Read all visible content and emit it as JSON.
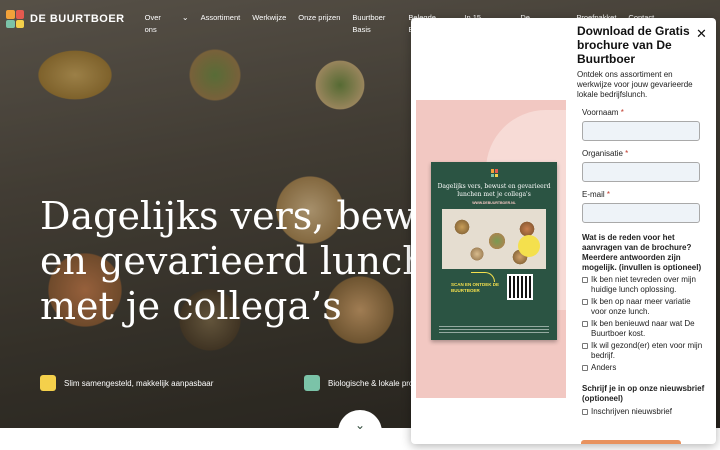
{
  "brand": {
    "name": "DE BUURTBOER",
    "logo_colors": [
      "#f2a23a",
      "#e55a4f",
      "#7bc3a8",
      "#f4d04b"
    ]
  },
  "nav": {
    "items": [
      {
        "label": "Over ons",
        "has_chevron": true
      },
      {
        "label": "Assortiment",
        "has_chevron": false
      },
      {
        "label": "Werkwijze",
        "has_chevron": false
      },
      {
        "label": "Onze prijzen",
        "has_chevron": false
      },
      {
        "label": "Buurtboer Basis",
        "has_chevron": false
      },
      {
        "label": "Belegde Broodjes",
        "has_chevron": false
      },
      {
        "label": "In 15 minuten advies",
        "has_chevron": false
      },
      {
        "label": "De Buurtboer",
        "has_chevron": false
      },
      {
        "label": "Proefpakket",
        "has_chevron": false
      },
      {
        "label": "Contact",
        "has_chevron": false
      }
    ]
  },
  "hero": {
    "headline_lines": [
      "Dagelijks vers, bewust",
      "en gevarieerd lunchen",
      "met je collega’s"
    ]
  },
  "usps": [
    {
      "label": "Slim samengesteld, makkelijk aanpasbaar",
      "icon": "puzzle-icon",
      "color": "#f4d04b"
    },
    {
      "label": "Biologische & lokale producten",
      "icon": "leaf-icon",
      "color": "#7bc3a8"
    }
  ],
  "scroll_button": {
    "icon": "chevron-down-icon",
    "glyph": "⌄"
  },
  "modal": {
    "title": "Download de Gratis brochure van De Buurtboer",
    "close_glyph": "✕",
    "subtitle": "Ontdek ons assortiment en werkwijze voor jouw gevarieerde lokale bedrijfslunch.",
    "fields": [
      {
        "label": "Voornaam",
        "required": true,
        "value": ""
      },
      {
        "label": "Organisatie",
        "required": true,
        "value": ""
      },
      {
        "label": "E-mail",
        "required": true,
        "value": ""
      }
    ],
    "question": "Wat is de reden voor het aanvragen van de brochure? Meerdere antwoorden zijn mogelijk. (invullen is optioneel)",
    "reasons": [
      "Ik ben niet tevreden over mijn huidige lunch oplossing.",
      "Ik ben op naar meer variatie voor onze lunch.",
      "Ik ben benieuwd naar wat De Buurtboer kost.",
      "Ik wil gezond(er) eten voor mijn bedrijf.",
      "Anders"
    ],
    "newsletter_title": "Schrijf je in op onze nieuwsbrief (optioneel)",
    "newsletter_option": "Inschrijven nieuwsbrief",
    "brochure": {
      "title": "Dagelijks vers, bewust en gevarieerd lunchen met je collega's",
      "url": "WWW.DEBUURTBOER.NL",
      "scan_text": "SCAN EN ONTDEK DE BUURTBOER"
    },
    "accent_color": "#2b5443",
    "pink_color": "#f2c8c2"
  }
}
